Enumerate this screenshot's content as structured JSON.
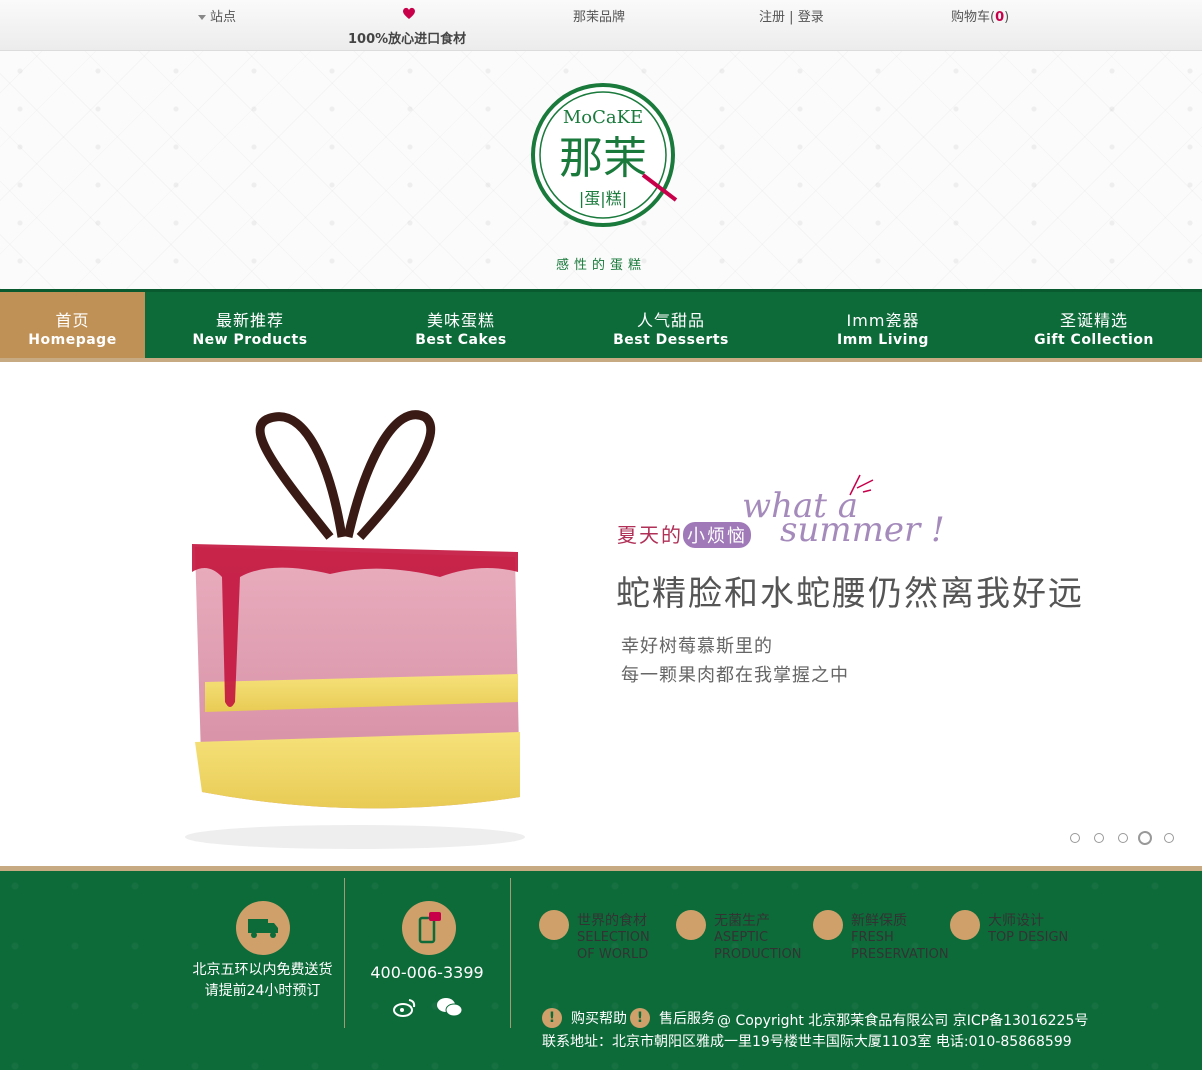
{
  "topbar": {
    "site_label": "站点",
    "tagline": "100%放心进口食材",
    "brand_label": "那茉品牌",
    "register_label": "注册",
    "separator": "|",
    "login_label": "登录",
    "cart_label": "购物车",
    "cart_count_open": "(",
    "cart_count": "0",
    "cart_count_close": ")"
  },
  "header": {
    "logo_en": "MoCaKE",
    "logo_cn": "那茉",
    "logo_sub": "|蛋|糕|",
    "slogan": "感性的蛋糕"
  },
  "nav": {
    "items": [
      {
        "cn": "首页",
        "en": "Homepage"
      },
      {
        "cn": "最新推荐",
        "en": "New Products"
      },
      {
        "cn": "美味蛋糕",
        "en": "Best Cakes"
      },
      {
        "cn": "人气甜品",
        "en": "Best Desserts"
      },
      {
        "cn": "Imm瓷器",
        "en": "Imm Living"
      },
      {
        "cn": "圣诞精选",
        "en": "Gift Collection"
      }
    ]
  },
  "banner": {
    "script_line1": "what a",
    "script_line2": "summer !",
    "small_cn_prefix": "夏天的",
    "small_cn_badge": "小烦恼",
    "headline": "蛇精脸和水蛇腰仍然离我好远",
    "sub1": "幸好树莓慕斯里的",
    "sub2": "每一颗果肉都在我掌握之中",
    "slide_count": 5,
    "active_slide": 4
  },
  "footer": {
    "delivery_line1": "北京五环以内免费送货",
    "delivery_line2": "请提前24小时预订",
    "phone": "400-006-3399",
    "features": [
      {
        "cn": "世界的食材",
        "en1": "SELECTION",
        "en2": "OF WORLD",
        "icon": "globe-icon"
      },
      {
        "cn": "无菌生产",
        "en1": "ASEPTIC",
        "en2": "PRODUCTION",
        "icon": "thermometer-icon"
      },
      {
        "cn": "新鲜保质",
        "en1": "FRESH",
        "en2": "PRESERVATION",
        "icon": "leaf-icon"
      },
      {
        "cn": "大师设计",
        "en1": "TOP DESIGN",
        "en2": "",
        "icon": "pencil-icon"
      }
    ],
    "help_label": "购买帮助",
    "service_label": "售后服务",
    "copyright": "@ Copyright 北京那茉食品有限公司 京ICP备13016225号",
    "address": "联系地址：北京市朝阳区雅成一里19号楼世丰国际大厦1103室 电话:010-85868599"
  },
  "colors": {
    "brand_green": "#0d6b3a",
    "accent_gold": "#c09156",
    "accent_pink": "#c8004a"
  }
}
